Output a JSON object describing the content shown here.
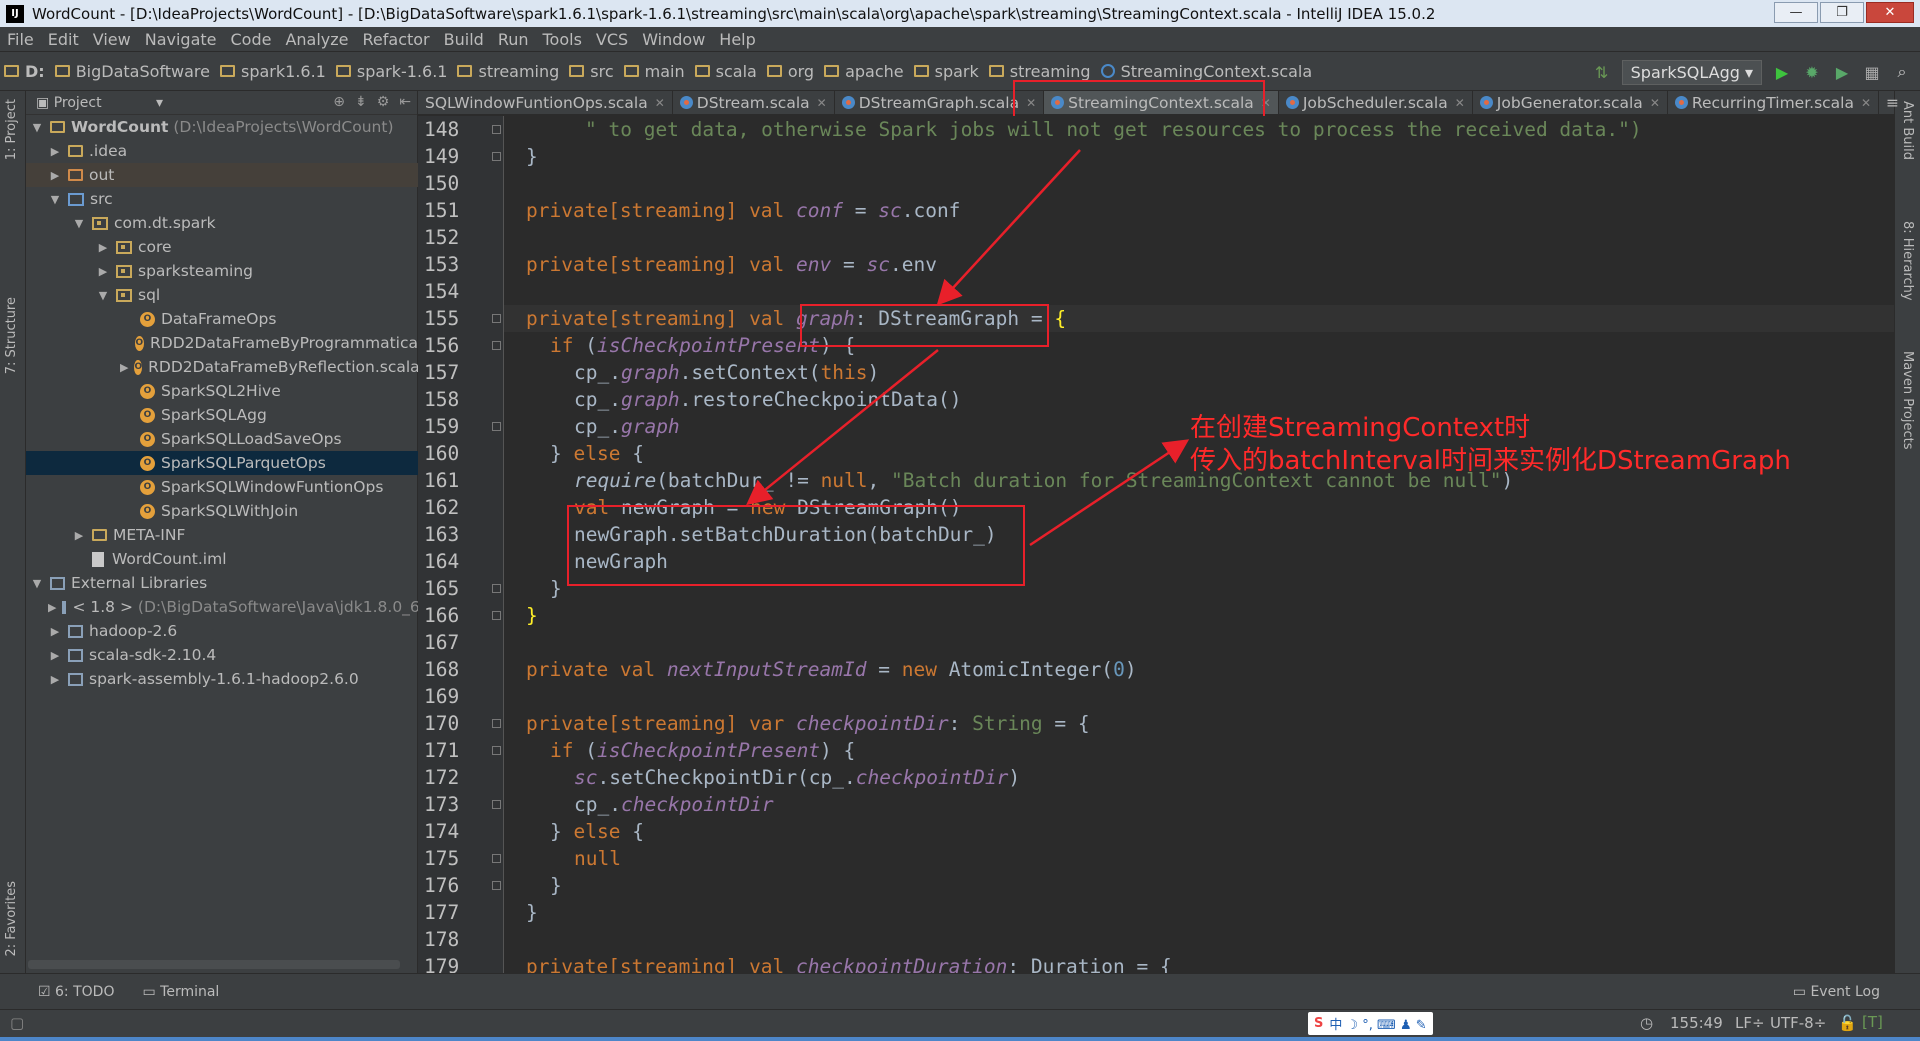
{
  "window": {
    "title": "WordCount - [D:\\IdeaProjects\\WordCount] - [D:\\BigDataSoftware\\spark1.6.1\\spark-1.6.1\\streaming\\src\\main\\scala\\org\\apache\\spark\\streaming\\StreamingContext.scala - IntelliJ IDEA 15.0.2",
    "minimize": "—",
    "maximize": "❐",
    "close": "✕"
  },
  "menu": [
    "File",
    "Edit",
    "View",
    "Navigate",
    "Code",
    "Analyze",
    "Refactor",
    "Build",
    "Run",
    "Tools",
    "VCS",
    "Window",
    "Help"
  ],
  "breadcrumbs": [
    "D:",
    "BigDataSoftware",
    "spark1.6.1",
    "spark-1.6.1",
    "streaming",
    "src",
    "main",
    "scala",
    "org",
    "apache",
    "spark",
    "streaming",
    "StreamingContext.scala"
  ],
  "run_config": "SparkSQLAgg",
  "left_tool_tabs": {
    "project": "1: Project",
    "structure": "7: Structure",
    "favorites": "2: Favorites"
  },
  "right_tool_tabs": {
    "ant": "Ant Build",
    "hierarchy": "8: Hierarchy",
    "maven": "Maven Projects"
  },
  "project_panel": {
    "header": "Project",
    "tree": [
      {
        "label": "WordCount",
        "path": "(D:\\IdeaProjects\\WordCount)"
      },
      {
        "label": ".idea"
      },
      {
        "label": "out"
      },
      {
        "label": "src"
      },
      {
        "label": "com.dt.spark"
      },
      {
        "label": "core"
      },
      {
        "label": "sparksteaming"
      },
      {
        "label": "sql"
      },
      {
        "label": "DataFrameOps"
      },
      {
        "label": "RDD2DataFrameByProgrammatica"
      },
      {
        "label": "RDD2DataFrameByReflection.scala"
      },
      {
        "label": "SparkSQL2Hive"
      },
      {
        "label": "SparkSQLAgg"
      },
      {
        "label": "SparkSQLLoadSaveOps"
      },
      {
        "label": "SparkSQLParquetOps"
      },
      {
        "label": "SparkSQLWindowFuntionOps"
      },
      {
        "label": "SparkSQLWithJoin"
      },
      {
        "label": "META-INF"
      },
      {
        "label": "WordCount.iml"
      },
      {
        "label": "External Libraries"
      },
      {
        "label": "< 1.8 >",
        "path": "(D:\\BigDataSoftware\\Java\\jdk1.8.0_6"
      },
      {
        "label": "hadoop-2.6"
      },
      {
        "label": "scala-sdk-2.10.4"
      },
      {
        "label": "spark-assembly-1.6.1-hadoop2.6.0"
      }
    ]
  },
  "tabs": [
    "SQLWindowFuntionOps.scala",
    "DStream.scala",
    "DStreamGraph.scala",
    "StreamingContext.scala",
    "JobScheduler.scala",
    "JobGenerator.scala",
    "RecurringTimer.scala"
  ],
  "line_numbers": [
    "148",
    "149",
    "150",
    "151",
    "152",
    "153",
    "154",
    "155",
    "156",
    "157",
    "158",
    "159",
    "160",
    "161",
    "162",
    "163",
    "164",
    "165",
    "166",
    "167",
    "168",
    "169",
    "170",
    "171",
    "172",
    "173",
    "174",
    "175",
    "176",
    "177",
    "178",
    "179"
  ],
  "code": {
    "l148": "\" to get data, otherwise Spark jobs will not get resources to process the received data.\")",
    "l149": "}",
    "l151_a": "private[streaming] ",
    "l151_kw": "val ",
    "l151_f": "conf",
    "l151_b": " = ",
    "l151_sc": "sc",
    "l151_c": ".conf",
    "l153_a": "private[streaming] ",
    "l153_kw": "val ",
    "l153_f": "env",
    "l153_b": " = ",
    "l153_sc": "sc",
    "l153_c": ".env",
    "l155_a": "private[streaming] ",
    "l155_kw": "val ",
    "l155_f": "graph",
    "l155_b": ": DStreamGraph = ",
    "l155_br": "{",
    "l156_kw": "if ",
    "l156_a": "(",
    "l156_f": "isCheckpointPresent",
    "l156_b": ") {",
    "l157_a": "cp_.",
    "l157_f": "graph",
    "l157_b": ".setContext(",
    "l157_kw": "this",
    "l157_c": ")",
    "l158_a": "cp_.",
    "l158_f": "graph",
    "l158_b": ".restoreCheckpointData()",
    "l159_a": "cp_.",
    "l159_f": "graph",
    "l160_a": "} ",
    "l160_kw": "else",
    "l160_b": " {",
    "l161_i": "require",
    "l161_a": "(batchDur_ != ",
    "l161_kw": "null",
    "l161_b": ", ",
    "l161_s": "\"Batch duration for StreamingContext cannot be null\"",
    "l161_c": ")",
    "l162_kw": "val ",
    "l162_a": "newGraph = ",
    "l162_kw2": "new ",
    "l162_b": "DStreamGraph()",
    "l163": "newGraph.setBatchDuration(batchDur_)",
    "l164": "newGraph",
    "l165": "}",
    "l166": "}",
    "l168_kw": "private val ",
    "l168_f": "nextInputStreamId",
    "l168_a": " = ",
    "l168_kw2": "new ",
    "l168_b": "AtomicInteger(",
    "l168_n": "0",
    "l168_c": ")",
    "l170_a": "private[streaming] ",
    "l170_kw": "var ",
    "l170_f": "checkpointDir",
    "l170_b": ": ",
    "l170_t": "String",
    "l170_c": " = {",
    "l171_kw": "if ",
    "l171_a": "(",
    "l171_f": "isCheckpointPresent",
    "l171_b": ") {",
    "l172_sc": "sc",
    "l172_a": ".setCheckpointDir(cp_.",
    "l172_f": "checkpointDir",
    "l172_b": ")",
    "l173_a": "cp_.",
    "l173_f": "checkpointDir",
    "l174_a": "} ",
    "l174_kw": "else",
    "l174_b": " {",
    "l175_kw": "null",
    "l176": "}",
    "l177": "}",
    "l179_a": "private[streaming] ",
    "l179_kw": "val ",
    "l179_f": "checkpointDuration",
    "l179_b": ": Duration = {"
  },
  "annotation": {
    "line1": "在创建StreamingContext时",
    "line2": "传入的batchInterval时间来实例化DStreamGraph"
  },
  "bottom_tools": {
    "todo": "6: TODO",
    "terminal": "Terminal",
    "event_log": "Event Log"
  },
  "status": {
    "position": "155:49",
    "line_sep": "LF÷",
    "encoding": "UTF-8÷"
  },
  "colors": {
    "keyword": "#cc7832",
    "field": "#9876aa",
    "string": "#6a8759",
    "number": "#6897bb",
    "annotation": "#ff2a2a",
    "highlight_box": "#e8202a"
  }
}
